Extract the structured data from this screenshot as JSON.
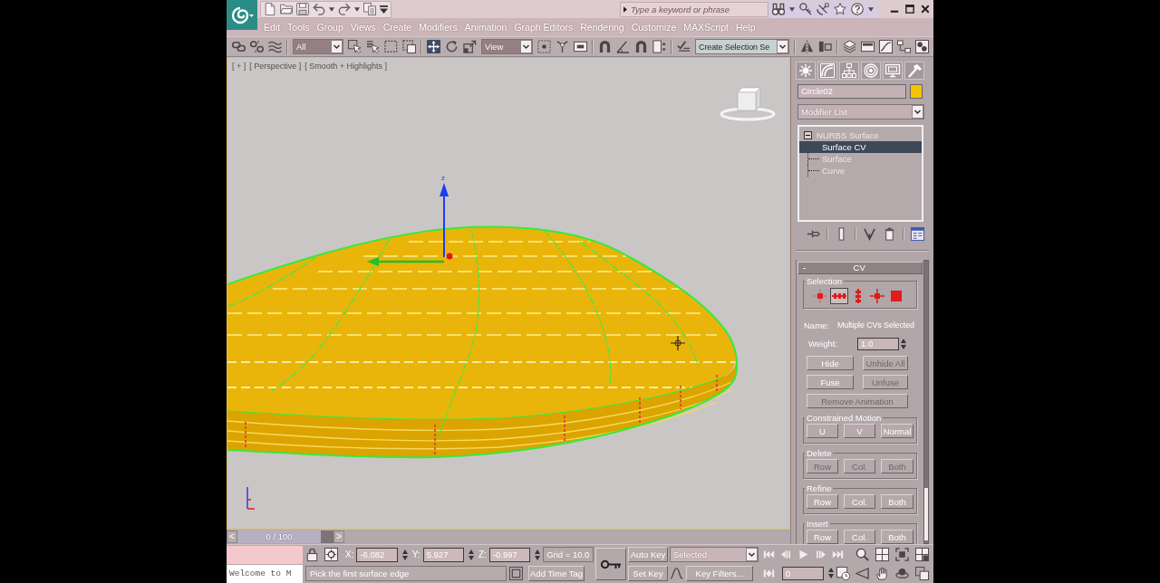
{
  "title_bar": {
    "search": {
      "placeholder": "Type a keyword or phrase"
    }
  },
  "menu": [
    "Edit",
    "Tools",
    "Group",
    "Views",
    "Create",
    "Modifiers",
    "Animation",
    "Graph Editors",
    "Rendering",
    "Customize",
    "MAXScript",
    "Help"
  ],
  "main_toolbar": {
    "selection_filter": "All",
    "transform_tools": [
      {
        "selected": true
      },
      {
        "selected": false
      },
      {
        "selected": false
      }
    ],
    "reference_coordinate": "View",
    "named_selection_set": "Create Selection Se"
  },
  "viewport": {
    "labels": [
      "[ + ]",
      "[ Perspective ]",
      "[ Smooth + Highlights ]"
    ],
    "active": true,
    "gizmo_label": "z"
  },
  "command_panel": {
    "object_name": "Circle02",
    "modifier_list": "Modifier List",
    "stack": [
      {
        "label": "NURBS Surface",
        "expanded": true,
        "selected": false,
        "children": [
          {
            "label": "Surface CV",
            "selected": true
          },
          {
            "label": "Surface",
            "selected": false
          },
          {
            "label": "Curve",
            "selected": false
          }
        ]
      }
    ],
    "rollout": {
      "toggle": "-",
      "title": "CV",
      "selection": {
        "title": "Selection",
        "levels": [
          {
            "selected": false
          },
          {
            "selected": true
          },
          {
            "selected": false
          },
          {
            "selected": false
          },
          {
            "selected": false
          }
        ]
      },
      "name_label": "Name:",
      "name_value": "Multiple CVs Selected",
      "weight": {
        "label": "Weight:",
        "value": "1.0"
      },
      "buttons": [
        {
          "label": "Hide",
          "disabled": false
        },
        {
          "label": "Unhide All",
          "disabled": true
        },
        {
          "label": "Fuse",
          "disabled": false
        },
        {
          "label": "Unfuse",
          "disabled": true
        },
        {
          "label": "Remove Animation",
          "disabled": true
        }
      ],
      "groups": [
        {
          "title": "Constrained Motion",
          "buttons": [
            {
              "label": "U",
              "disabled": false
            },
            {
              "label": "V",
              "disabled": false
            },
            {
              "label": "Normal",
              "disabled": false
            }
          ]
        },
        {
          "title": "Delete",
          "buttons": [
            {
              "label": "Row",
              "disabled": true
            },
            {
              "label": "Col.",
              "disabled": true
            },
            {
              "label": "Both",
              "disabled": true
            }
          ]
        },
        {
          "title": "Refine",
          "buttons": [
            {
              "label": "Row",
              "disabled": false
            },
            {
              "label": "Col.",
              "disabled": false
            },
            {
              "label": "Both",
              "disabled": false
            }
          ]
        },
        {
          "title": "Insert",
          "buttons": [
            {
              "label": "Row",
              "disabled": false
            },
            {
              "label": "Col.",
              "disabled": false
            },
            {
              "label": "Both",
              "disabled": false
            }
          ]
        }
      ]
    }
  },
  "time_slider": {
    "previous": "<",
    "position": "0 / 100",
    "next": ">",
    "level": 0
  },
  "status_bar": {
    "listener": "Welcome to M",
    "coordinates": [
      {
        "axis": "X:",
        "value": "-6.082"
      },
      {
        "axis": "Y:",
        "value": "5.927"
      },
      {
        "axis": "Z:",
        "value": "-0.997"
      }
    ],
    "grid": "Grid = 10.0",
    "prompt": "Pick the first surface edge",
    "add_time_tag": "Add Time Tag",
    "auto_key": "Auto Key",
    "set_key": "Set Key",
    "key_set": "Selected",
    "key_filters": "Key Filters...",
    "frame": "0"
  }
}
